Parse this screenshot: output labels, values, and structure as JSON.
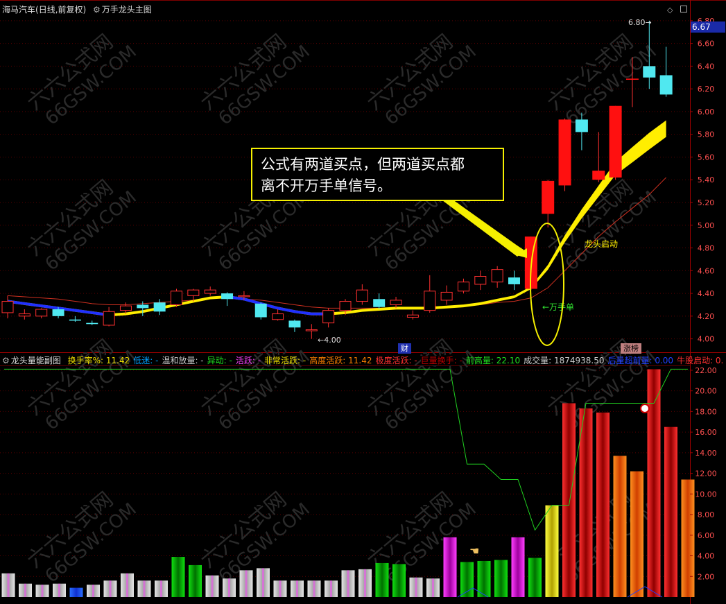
{
  "main_panel": {
    "stock_name": "海马汽车",
    "period": "(日线,前复权)",
    "indicator": "万手龙头主图",
    "price_ticks": [
      "6.80",
      "6.60",
      "6.40",
      "6.20",
      "6.00",
      "5.80",
      "5.60",
      "5.40",
      "5.20",
      "5.00",
      "4.80",
      "4.60",
      "4.40",
      "4.20",
      "4.00"
    ],
    "current_price": "6.67",
    "high_label": "6.80",
    "low_label": "4.00",
    "wanshou_label": "←万手单",
    "longtou_label": "龙头启动",
    "callout": [
      "公式有两道买点，但两道买点都",
      "离不开万手单信号。"
    ],
    "marker_cai": "财",
    "marker_zhangting": "涨榜"
  },
  "sub_panel": {
    "title": "龙头量能副图",
    "fields": [
      {
        "label": "换手率%:",
        "value": "11.42",
        "color": "#f0e000"
      },
      {
        "label": "低迷:",
        "value": "-",
        "color": "#00a0ff"
      },
      {
        "label": "温和放量:",
        "value": "-",
        "color": "#cccccc"
      },
      {
        "label": "异动:",
        "value": "-",
        "color": "#20e020"
      },
      {
        "label": "活跃:",
        "value": "-",
        "color": "#ff40ff"
      },
      {
        "label": "非常活跃:",
        "value": "-",
        "color": "#f0e000"
      },
      {
        "label": "高度活跃:",
        "value": "11.42",
        "color": "#ff8000"
      },
      {
        "label": "极度活跃:",
        "value": "-",
        "color": "#ff3030"
      },
      {
        "label": "巨量换手:",
        "value": "-",
        "color": "#c00000"
      },
      {
        "label": "前高量:",
        "value": "22.10",
        "color": "#20e020"
      },
      {
        "label": "成交量:",
        "value": "1874938.50",
        "color": "#cccccc"
      },
      {
        "label": "后量超前量:",
        "value": "0.00",
        "color": "#2040ff"
      },
      {
        "label": "牛股启动:",
        "value": "0.",
        "color": "#ff3030"
      }
    ],
    "vol_ticks": [
      "22.00",
      "20.00",
      "18.00",
      "16.00",
      "14.00",
      "12.00",
      "10.00",
      "8.00",
      "6.00",
      "4.00",
      "2.00"
    ]
  },
  "watermark": [
    "六六公式网",
    "66GSW.COM"
  ],
  "chart_data": [
    {
      "type": "candlestick",
      "title": "万手龙头主图",
      "ylim": [
        3.9,
        6.86
      ],
      "series": [
        {
          "name": "K线",
          "ohlc": [
            [
              4.23,
              4.33,
              4.38,
              4.18
            ],
            [
              4.2,
              4.22,
              4.26,
              4.17
            ],
            [
              4.2,
              4.26,
              4.27,
              4.18
            ],
            [
              4.26,
              4.2,
              4.28,
              4.18
            ],
            [
              4.17,
              4.16,
              4.2,
              4.15
            ],
            [
              4.14,
              4.13,
              4.16,
              4.12
            ],
            [
              4.12,
              4.24,
              4.28,
              4.11
            ],
            [
              4.25,
              4.29,
              4.32,
              4.22
            ],
            [
              4.3,
              4.27,
              4.33,
              4.2
            ],
            [
              4.32,
              4.24,
              4.35,
              4.21
            ],
            [
              4.3,
              4.42,
              4.44,
              4.28
            ],
            [
              4.38,
              4.43,
              4.44,
              4.33
            ],
            [
              4.4,
              4.43,
              4.46,
              4.38
            ],
            [
              4.4,
              4.35,
              4.41,
              4.29
            ],
            [
              4.38,
              4.38,
              4.42,
              4.34
            ],
            [
              4.31,
              4.19,
              4.32,
              4.17
            ],
            [
              4.17,
              4.22,
              4.26,
              4.16
            ],
            [
              4.16,
              4.1,
              4.17,
              4.06
            ],
            [
              4.08,
              4.08,
              4.13,
              4.0
            ],
            [
              4.14,
              4.25,
              4.27,
              4.1
            ],
            [
              4.25,
              4.33,
              4.35,
              4.21
            ],
            [
              4.33,
              4.43,
              4.48,
              4.3
            ],
            [
              4.35,
              4.28,
              4.4,
              4.26
            ],
            [
              4.3,
              4.34,
              4.37,
              4.27
            ],
            [
              4.19,
              4.21,
              4.25,
              4.17
            ],
            [
              4.25,
              4.42,
              4.56,
              4.23
            ],
            [
              4.34,
              4.41,
              4.47,
              4.3
            ],
            [
              4.42,
              4.5,
              4.53,
              4.4
            ],
            [
              4.48,
              4.55,
              4.6,
              4.43
            ],
            [
              4.5,
              4.61,
              4.64,
              4.45
            ],
            [
              4.54,
              4.48,
              4.6,
              4.43
            ],
            [
              4.44,
              4.9,
              4.9,
              4.43
            ],
            [
              5.1,
              5.39,
              5.4,
              4.98
            ],
            [
              5.35,
              5.93,
              5.94,
              5.3
            ],
            [
              5.93,
              5.82,
              5.99,
              5.66
            ],
            [
              5.4,
              5.48,
              5.82,
              5.38
            ],
            [
              5.42,
              6.05,
              6.05,
              5.4
            ],
            [
              6.28,
              6.29,
              6.48,
              6.04
            ],
            [
              6.4,
              6.3,
              6.8,
              6.2
            ],
            [
              6.32,
              6.15,
              6.57,
              6.13
            ]
          ]
        },
        {
          "name": "均线",
          "values": [
            4.33,
            4.31,
            4.29,
            4.27,
            4.25,
            4.23,
            4.21,
            4.22,
            4.24,
            4.27,
            4.3,
            4.33,
            4.36,
            4.37,
            4.35,
            4.31,
            4.27,
            4.24,
            4.22,
            4.22,
            4.23,
            4.25,
            4.26,
            4.27,
            4.27,
            4.27,
            4.28,
            4.29,
            4.31,
            4.34,
            4.37,
            4.45,
            4.63,
            4.88,
            5.1,
            5.3,
            5.5,
            5.62,
            5.74,
            5.85
          ]
        },
        {
          "name": "红线",
          "values": [
            4.38,
            4.37,
            4.36,
            4.35,
            4.33,
            4.31,
            4.3,
            4.3,
            4.31,
            4.32,
            4.33,
            4.34,
            4.36,
            4.36,
            4.35,
            4.34,
            4.32,
            4.3,
            4.28,
            4.27,
            4.27,
            4.27,
            4.27,
            4.27,
            4.27,
            4.28,
            4.28,
            4.29,
            4.3,
            4.32,
            4.33,
            4.36,
            4.45,
            4.6,
            4.75,
            4.9,
            5.03,
            5.15,
            5.27,
            5.42
          ]
        }
      ]
    },
    {
      "type": "bar",
      "title": "龙头量能副图",
      "ylim": [
        0,
        22.6
      ],
      "values": [
        2.3,
        1.3,
        1.2,
        1.3,
        0.9,
        1.2,
        1.6,
        2.3,
        1.6,
        1.6,
        3.9,
        3.1,
        2.1,
        1.8,
        2.6,
        2.8,
        1.6,
        1.6,
        1.6,
        1.6,
        2.6,
        2.7,
        3.3,
        3.2,
        1.9,
        1.8,
        5.8,
        3.4,
        3.5,
        3.6,
        5.8,
        3.8,
        8.9,
        18.8,
        18.3,
        17.9,
        13.7,
        12.2,
        22.1,
        16.5,
        11.4
      ],
      "colors": [
        "gray",
        "gray",
        "gray",
        "gray",
        "blue",
        "gray",
        "gray",
        "gray",
        "gray",
        "gray",
        "green",
        "green",
        "gray",
        "gray",
        "gray",
        "gray",
        "gray",
        "gray",
        "gray",
        "gray",
        "gray",
        "gray",
        "green",
        "green",
        "gray",
        "gray",
        "magenta",
        "green",
        "green",
        "green",
        "magenta",
        "green",
        "yellow",
        "red",
        "red",
        "red",
        "orange",
        "orange",
        "red",
        "red",
        "orange"
      ],
      "series": [
        {
          "name": "前高量线",
          "values": [
            22.1,
            22.1,
            22.1,
            22.1,
            22.1,
            22.1,
            22.1,
            22.1,
            22.1,
            22.1,
            22.1,
            22.1,
            22.1,
            22.1,
            22.1,
            22.1,
            22.1,
            22.1,
            22.1,
            22.1,
            22.1,
            22.1,
            22.1,
            22.1,
            22.1,
            22.1,
            22.1,
            12.9,
            12.9,
            11.4,
            11.4,
            6.5,
            8.9,
            8.9,
            18.8,
            18.8,
            18.8,
            18.8,
            18.8,
            22.1,
            22.1
          ]
        }
      ]
    }
  ]
}
